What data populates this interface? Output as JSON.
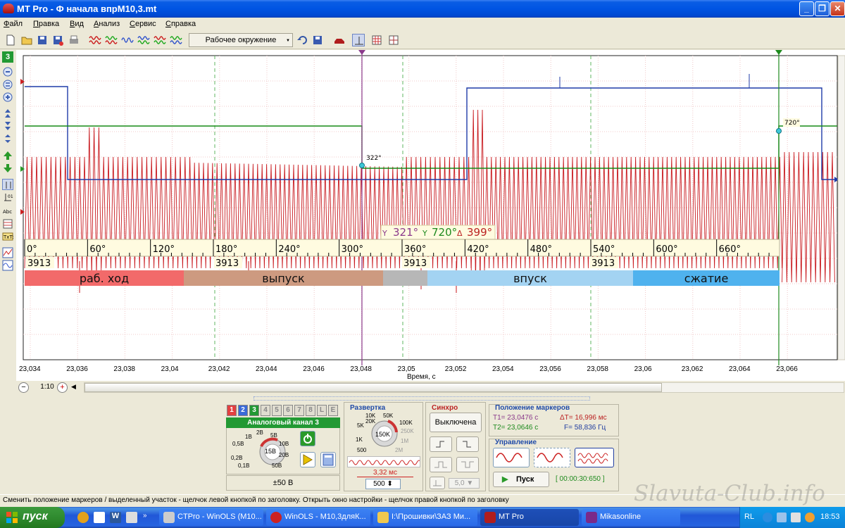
{
  "window": {
    "title": "MT Pro - Ф  начала впрМ10,3.mt"
  },
  "menu": [
    "Файл",
    "Правка",
    "Вид",
    "Анализ",
    "Сервис",
    "Справка"
  ],
  "toolbar": {
    "work_env": "Рабочее окружение"
  },
  "left_tools": {
    "channel_num": "3"
  },
  "plot": {
    "x_ticks": [
      "23,034",
      "23,036",
      "23,038",
      "23,04",
      "23,042",
      "23,044",
      "23,046",
      "23,048",
      "23,05",
      "23,052",
      "23,054",
      "23,056",
      "23,058",
      "23,06",
      "23,062",
      "23,064",
      "23,066"
    ],
    "xlabel": "Время, с",
    "marker1_label": "322°",
    "marker2_label": "720°",
    "degree_ticks": [
      "0°",
      "60°",
      "120°",
      "180°",
      "240°",
      "300°",
      "360°",
      "420°",
      "480°",
      "540°",
      "600°",
      "660°"
    ],
    "rpm_values": [
      "3913",
      "3913",
      "3913",
      "3913"
    ],
    "stroke_bar": [
      {
        "label": "раб. ход",
        "color": "#F26A6A"
      },
      {
        "label": "выпуск",
        "color": "#CD9A80"
      },
      {
        "label": "",
        "color": "#B7B7B7"
      },
      {
        "label": "впуск",
        "color": "#A3D3F2"
      },
      {
        "label": "сжатие",
        "color": "#4FB2EE"
      }
    ],
    "marker_readout": {
      "t1": "321°",
      "t2": "720°",
      "delta": "399°"
    }
  },
  "zoom": {
    "level": "1:10"
  },
  "channel_panel": {
    "tabs": [
      "1",
      "2",
      "3",
      "4",
      "5",
      "6",
      "7",
      "8",
      "L",
      "E"
    ],
    "active_tab": "3",
    "name": "Аналоговый канал 3",
    "knob_labels": [
      "0,5В",
      "1В",
      "2В",
      "5В",
      "10В",
      "20В",
      "50В",
      "0,1В",
      "0,2В"
    ],
    "knob_value": "15В",
    "range": "±50 В"
  },
  "sweep_panel": {
    "title": "Развертка",
    "knob_labels": [
      "5K",
      "10K",
      "20K",
      "50K",
      "100K",
      "250K",
      "1M",
      "2M",
      "500",
      "1K"
    ],
    "knob_value": "150K",
    "time": "3,32 мс",
    "points": "500"
  },
  "sync_panel": {
    "title": "Синхро",
    "mode": "Выключена",
    "level": "5,0 ▼"
  },
  "markers_panel": {
    "title": "Положение маркеров",
    "t1": "T1= 23,0476 с",
    "t2": "T2= 23,0646 с",
    "dt": "ΔT= 16,996 мс",
    "freq": "F= 58,836 Гц"
  },
  "control_panel": {
    "title": "Управление",
    "start": "Пуск",
    "timer": "[ 00:00:30:650 ]"
  },
  "status": "Сменить положение маркеров / выделенный участок - щелчок левой кнопкой по заголовку. Открыть окно настройки - щелчок правой кнопкой по заголовку",
  "watermark": "Slavuta-Club.info",
  "taskbar": {
    "start": "пуск",
    "tasks": [
      "CTPro - WinOLS (M10...",
      "WinOLS - M10,3дляК...",
      "I:\\Прошивки\\ЗАЗ Ми...",
      "MT Pro",
      "Mikasonline"
    ],
    "lang": "RL",
    "clock": "18:53"
  },
  "colors": {
    "signal": "#C8191E",
    "sync_high": "#1F3BA8",
    "cam": "#168A16",
    "marker1": "#8B3A8B",
    "marker2": "#1E8A1E"
  }
}
